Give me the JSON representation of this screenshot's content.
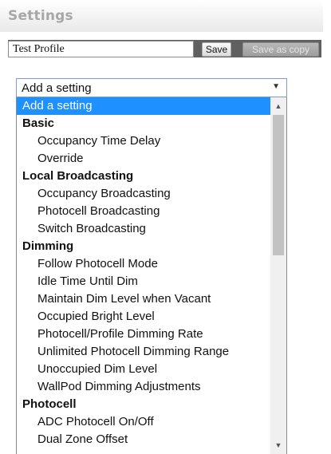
{
  "header": {
    "title": "Settings"
  },
  "profile": {
    "name_value": "Test Profile",
    "save_label": "Save",
    "save_as_copy_label": "Save as copy"
  },
  "select": {
    "value": "Add a setting",
    "arrow_icon": "triangle-down"
  },
  "dropdown": {
    "options": [
      {
        "label": "Add a setting",
        "kind": "selected"
      },
      {
        "label": "Basic",
        "kind": "group"
      },
      {
        "label": "Occupancy Time Delay",
        "kind": "item"
      },
      {
        "label": "Override",
        "kind": "item"
      },
      {
        "label": "Local Broadcasting",
        "kind": "group"
      },
      {
        "label": "Occupancy Broadcasting",
        "kind": "item"
      },
      {
        "label": "Photocell Broadcasting",
        "kind": "item"
      },
      {
        "label": "Switch Broadcasting",
        "kind": "item"
      },
      {
        "label": "Dimming",
        "kind": "group"
      },
      {
        "label": "Follow Photocell Mode",
        "kind": "item"
      },
      {
        "label": "Idle Time Until Dim",
        "kind": "item"
      },
      {
        "label": "Maintain Dim Level when Vacant",
        "kind": "item"
      },
      {
        "label": "Occupied Bright Level",
        "kind": "item"
      },
      {
        "label": "Photocell/Profile Dimming Rate",
        "kind": "item"
      },
      {
        "label": "Unlimited Photocell Dimming Range",
        "kind": "item"
      },
      {
        "label": "Unoccupied Dim Level",
        "kind": "item"
      },
      {
        "label": "WallPod Dimming Adjustments",
        "kind": "item"
      },
      {
        "label": "Photocell",
        "kind": "group"
      },
      {
        "label": "ADC Photocell On/Off",
        "kind": "item"
      },
      {
        "label": "Dual Zone Offset",
        "kind": "item"
      }
    ],
    "scroll_up_icon": "triangle-up",
    "scroll_down_icon": "triangle-down"
  }
}
